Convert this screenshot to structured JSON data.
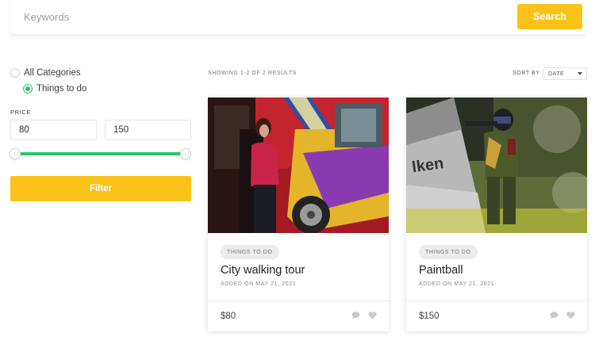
{
  "search": {
    "placeholder": "Keywords",
    "value": "",
    "button_label": "Search"
  },
  "sidebar": {
    "categories": [
      {
        "label": "All Categories",
        "selected": false
      },
      {
        "label": "Things to do",
        "selected": true
      }
    ],
    "price": {
      "label": "PRICE",
      "min": "80",
      "max": "150"
    },
    "filter_label": "Filter"
  },
  "results": {
    "showing_text": "SHOWING 1-2 OF 2 RESULTS",
    "sort_label": "SORT BY",
    "sort_value": "DATE"
  },
  "cards": [
    {
      "tag": "THINGS TO DO",
      "title": "City walking tour",
      "date": "ADDED ON MAY 21, 2021",
      "price": "$80",
      "image": "bus-tour-photo"
    },
    {
      "tag": "THINGS TO DO",
      "title": "Paintball",
      "date": "ADDED ON MAY 21, 2021",
      "price": "$150",
      "image": "paintball-photo"
    }
  ],
  "colors": {
    "accent": "#fbc319",
    "green": "#2cc56f"
  },
  "icons": [
    "comment-icon",
    "heart-icon",
    "chevron-down-icon"
  ]
}
